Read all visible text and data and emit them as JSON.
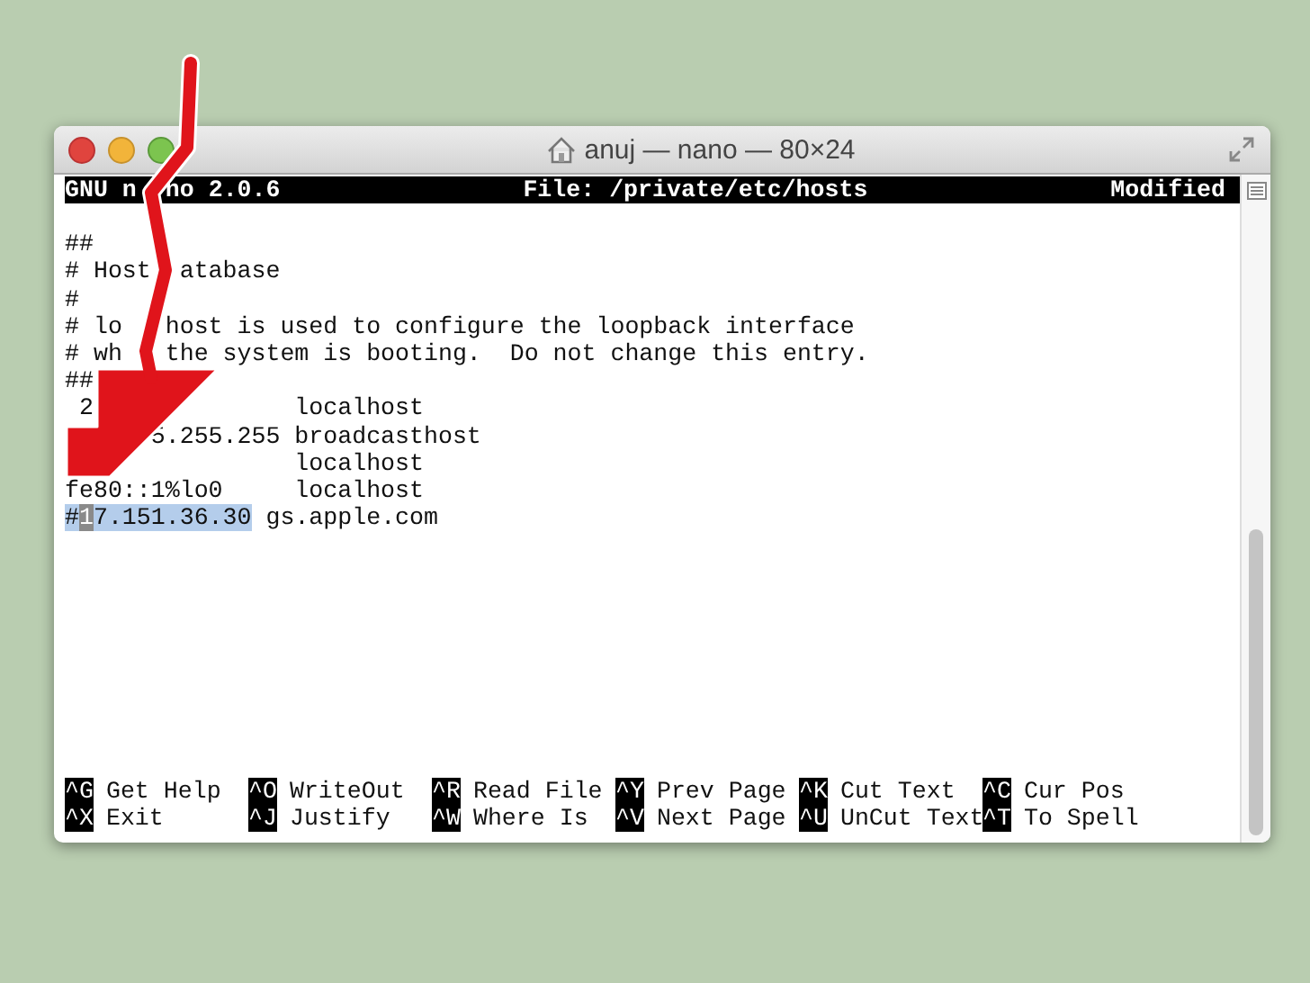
{
  "window": {
    "title": "anuj — nano — 80×24"
  },
  "header": {
    "left": [
      "GNU n",
      "no 2.0.6"
    ],
    "center": "File: /private/etc/hosts",
    "right": "Modified"
  },
  "lines": [
    {
      "segments": [
        {
          "kind": "text",
          "text": "##"
        }
      ]
    },
    {
      "segments": [
        {
          "kind": "text",
          "text": "# Host"
        },
        {
          "kind": "text",
          "text": "  atabase"
        }
      ]
    },
    {
      "segments": [
        {
          "kind": "text",
          "text": "#"
        }
      ]
    },
    {
      "segments": [
        {
          "kind": "text",
          "text": "# lo"
        },
        {
          "kind": "text",
          "text": "   host is used to configure the loopback interface"
        }
      ]
    },
    {
      "segments": [
        {
          "kind": "text",
          "text": "# wh"
        },
        {
          "kind": "text",
          "text": "   the system is booting.  Do not change this entry."
        }
      ]
    },
    {
      "segments": [
        {
          "kind": "text",
          "text": "##"
        }
      ]
    },
    {
      "segments": [
        {
          "kind": "text",
          "text": " 2"
        },
        {
          "kind": "text",
          "text": "              localhost"
        }
      ]
    },
    {
      "segments": [
        {
          "kind": "text",
          "text": "      5.255.255 broadcasthost"
        }
      ]
    },
    {
      "segments": [
        {
          "kind": "text",
          "text": "                localhost"
        }
      ]
    },
    {
      "segments": [
        {
          "kind": "text",
          "text": "fe80::1%lo0     localhost"
        }
      ]
    },
    {
      "segments": [
        {
          "kind": "selection",
          "text": "#"
        },
        {
          "kind": "cursor",
          "text": "1"
        },
        {
          "kind": "selection",
          "text": "7.151.36.30"
        },
        {
          "kind": "text",
          "text": " gs.apple.com"
        }
      ]
    }
  ],
  "shortcuts": [
    [
      {
        "key": "^G",
        "label": "Get Help"
      },
      {
        "key": "^O",
        "label": "WriteOut"
      },
      {
        "key": "^R",
        "label": "Read File"
      },
      {
        "key": "^Y",
        "label": "Prev Page"
      },
      {
        "key": "^K",
        "label": "Cut Text"
      },
      {
        "key": "^C",
        "label": "Cur Pos"
      }
    ],
    [
      {
        "key": "^X",
        "label": "Exit"
      },
      {
        "key": "^J",
        "label": "Justify"
      },
      {
        "key": "^W",
        "label": "Where Is"
      },
      {
        "key": "^V",
        "label": "Next Page"
      },
      {
        "key": "^U",
        "label": "UnCut Text"
      },
      {
        "key": "^T",
        "label": "To Spell"
      }
    ]
  ]
}
